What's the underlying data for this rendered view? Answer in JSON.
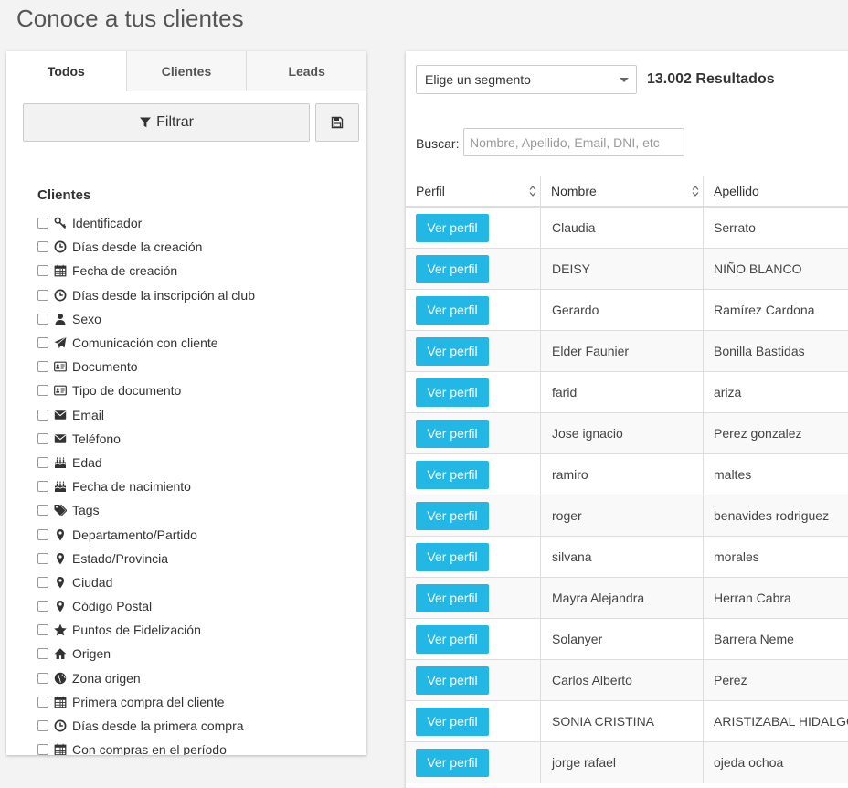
{
  "page_title": "Conoce a tus clientes",
  "tabs": [
    {
      "label": "Todos",
      "active": true
    },
    {
      "label": "Clientes",
      "active": false
    },
    {
      "label": "Leads",
      "active": false
    }
  ],
  "filter": {
    "button_label": "Filtrar"
  },
  "fields_section": {
    "title": "Clientes",
    "items": [
      {
        "label": "Identificador",
        "icon": "key-icon"
      },
      {
        "label": "Días desde la creación",
        "icon": "clock-icon"
      },
      {
        "label": "Fecha de creación",
        "icon": "calendar-icon"
      },
      {
        "label": "Días desde la inscripción al club",
        "icon": "clock-icon"
      },
      {
        "label": "Sexo",
        "icon": "user-icon"
      },
      {
        "label": "Comunicación con cliente",
        "icon": "paper-plane-icon"
      },
      {
        "label": "Documento",
        "icon": "id-card-icon"
      },
      {
        "label": "Tipo de documento",
        "icon": "id-card-icon"
      },
      {
        "label": "Email",
        "icon": "envelope-icon"
      },
      {
        "label": "Teléfono",
        "icon": "envelope-icon"
      },
      {
        "label": "Edad",
        "icon": "birthday-cake-icon"
      },
      {
        "label": "Fecha de nacimiento",
        "icon": "birthday-cake-icon"
      },
      {
        "label": "Tags",
        "icon": "tags-icon"
      },
      {
        "label": "Departamento/Partido",
        "icon": "map-marker-icon"
      },
      {
        "label": "Estado/Provincia",
        "icon": "map-marker-icon"
      },
      {
        "label": "Ciudad",
        "icon": "map-marker-icon"
      },
      {
        "label": "Código Postal",
        "icon": "map-marker-icon"
      },
      {
        "label": "Puntos de Fidelización",
        "icon": "star-icon"
      },
      {
        "label": "Origen",
        "icon": "home-icon"
      },
      {
        "label": "Zona origen",
        "icon": "globe-icon"
      },
      {
        "label": "Primera compra del cliente",
        "icon": "calendar-icon"
      },
      {
        "label": "Días desde la primera compra",
        "icon": "clock-icon"
      },
      {
        "label": "Con compras en el período",
        "icon": "calendar-icon"
      }
    ]
  },
  "segment": {
    "selected": "Elige un segmento"
  },
  "results_text": "13.002 Resultados",
  "search": {
    "label": "Buscar:",
    "placeholder": "Nombre, Apellido, Email, DNI, etc",
    "value": ""
  },
  "table": {
    "headers": [
      "Perfil",
      "Nombre",
      "Apellido"
    ],
    "button_label": "Ver perfil",
    "rows": [
      {
        "nombre": "Claudia",
        "apellido": "Serrato"
      },
      {
        "nombre": "DEISY",
        "apellido": "NIÑO BLANCO"
      },
      {
        "nombre": "Gerardo",
        "apellido": "Ramírez Cardona"
      },
      {
        "nombre": "Elder Faunier",
        "apellido": "Bonilla Bastidas"
      },
      {
        "nombre": "farid",
        "apellido": "ariza"
      },
      {
        "nombre": "Jose ignacio",
        "apellido": "Perez gonzalez"
      },
      {
        "nombre": "ramiro",
        "apellido": "maltes"
      },
      {
        "nombre": "roger",
        "apellido": "benavides rodriguez"
      },
      {
        "nombre": "silvana",
        "apellido": "morales"
      },
      {
        "nombre": "Mayra Alejandra",
        "apellido": "Herran Cabra"
      },
      {
        "nombre": "Solanyer",
        "apellido": "Barrera Neme"
      },
      {
        "nombre": "Carlos Alberto",
        "apellido": "Perez"
      },
      {
        "nombre": "SONIA CRISTINA",
        "apellido": "ARISTIZABAL HIDALGO"
      },
      {
        "nombre": "jorge rafael",
        "apellido": "ojeda ochoa"
      }
    ]
  },
  "colors": {
    "accent": "#23b7e5",
    "background": "#f3f3f4"
  }
}
